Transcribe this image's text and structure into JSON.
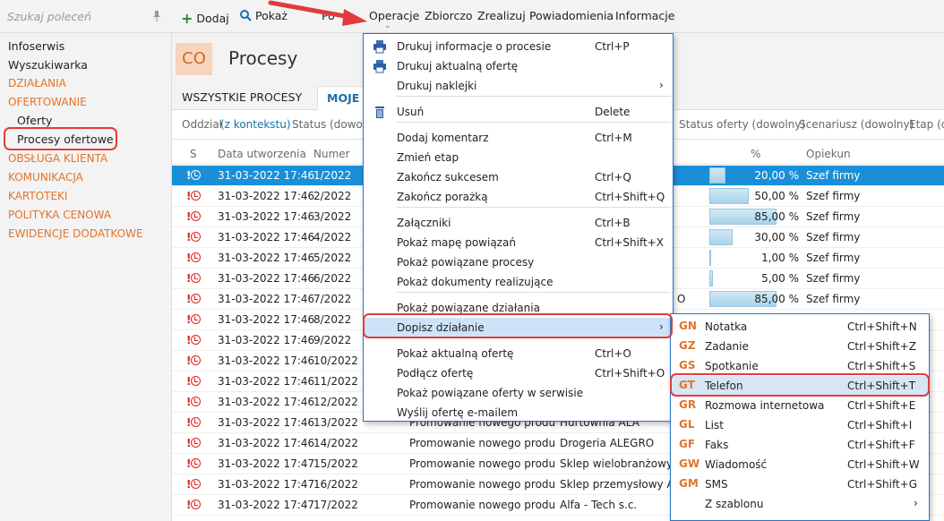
{
  "sidebar": {
    "search_placeholder": "Szukaj poleceń",
    "items": [
      {
        "label": "Infoserwis",
        "type": "plain"
      },
      {
        "label": "Wyszukiwarka",
        "type": "plain"
      },
      {
        "label": "DZIAŁANIA",
        "type": "category"
      },
      {
        "label": "OFERTOWANIE",
        "type": "category"
      },
      {
        "label": "Oferty",
        "type": "sub"
      },
      {
        "label": "Procesy ofertowe",
        "type": "sub"
      },
      {
        "label": "OBSŁUGA KLIENTA",
        "type": "category"
      },
      {
        "label": "KOMUNIKACJA",
        "type": "category"
      },
      {
        "label": "KARTOTEKI",
        "type": "category"
      },
      {
        "label": "POLITYKA CENOWA",
        "type": "category"
      },
      {
        "label": "EWIDENCJE DODATKOWE",
        "type": "category"
      }
    ]
  },
  "toolbar": {
    "add": "Dodaj",
    "show": "Pokaż",
    "hidden_item": "Po",
    "menus": [
      "Operacje",
      "Zbiorczo",
      "Zrealizuj",
      "Powiadomienia",
      "Informacje"
    ]
  },
  "page": {
    "badge": "CO",
    "title": "Procesy",
    "tabs": [
      "WSZYSTKIE PROCESY",
      "MOJE"
    ],
    "filter_dept_label": "Oddział",
    "filter_dept_value": "(z kontekstu)",
    "filter_status": "Status (dowolny)",
    "filter_offer_status": "Status oferty (dowolny)",
    "filter_scenario": "Scenariusz (dowolny)",
    "filter_stage": "Etap (dowolny)"
  },
  "table": {
    "columns": {
      "s": "S",
      "date": "Data utworzenia",
      "number": "Numer",
      "percent": "%",
      "owner": "Opiekun"
    },
    "rows": [
      {
        "date": "31-03-2022 17:46",
        "number": "1/2022",
        "name": "",
        "client": "",
        "percent": 20,
        "percent_label": "20,00 %",
        "owner": "Szef firmy"
      },
      {
        "date": "31-03-2022 17:46",
        "number": "2/2022",
        "name": "",
        "client": "",
        "percent": 50,
        "percent_label": "50,00 %",
        "owner": "Szef firmy"
      },
      {
        "date": "31-03-2022 17:46",
        "number": "3/2022",
        "name": "",
        "client": "",
        "percent": 85,
        "percent_label": "85,00 %",
        "owner": "Szef firmy"
      },
      {
        "date": "31-03-2022 17:46",
        "number": "4/2022",
        "name": "",
        "client": "",
        "percent": 30,
        "percent_label": "30,00 %",
        "owner": "Szef firmy"
      },
      {
        "date": "31-03-2022 17:46",
        "number": "5/2022",
        "name": "",
        "client": "",
        "percent": 1,
        "percent_label": "1,00 %",
        "owner": "Szef firmy"
      },
      {
        "date": "31-03-2022 17:46",
        "number": "6/2022",
        "name": "",
        "client": "",
        "percent": 5,
        "percent_label": "5,00 %",
        "owner": "Szef firmy"
      },
      {
        "date": "31-03-2022 17:46",
        "number": "7/2022",
        "name": "",
        "client": "O",
        "percent": 85,
        "percent_label": "85,00 %",
        "owner": "Szef firmy"
      },
      {
        "date": "31-03-2022 17:46",
        "number": "8/2022",
        "name": "",
        "client": "",
        "percent": null,
        "percent_label": "",
        "owner": ""
      },
      {
        "date": "31-03-2022 17:46",
        "number": "9/2022",
        "name": "",
        "client": "",
        "percent": null,
        "percent_label": "",
        "owner": ""
      },
      {
        "date": "31-03-2022 17:46",
        "number": "10/2022",
        "name": "",
        "client": "",
        "percent": null,
        "percent_label": "",
        "owner": ""
      },
      {
        "date": "31-03-2022 17:46",
        "number": "11/2022",
        "name": "",
        "client": "",
        "percent": null,
        "percent_label": "",
        "owner": ""
      },
      {
        "date": "31-03-2022 17:46",
        "number": "12/2022",
        "name": "",
        "client": "",
        "percent": null,
        "percent_label": "",
        "owner": ""
      },
      {
        "date": "31-03-2022 17:46",
        "number": "13/2022",
        "name": "Promowanie nowego produ...",
        "client": "Hurtownia ALA",
        "percent": null,
        "percent_label": "",
        "owner": ""
      },
      {
        "date": "31-03-2022 17:46",
        "number": "14/2022",
        "name": "Promowanie nowego produ...",
        "client": "Drogeria ALEGRO",
        "percent": null,
        "percent_label": "",
        "owner": ""
      },
      {
        "date": "31-03-2022 17:47",
        "number": "15/2022",
        "name": "Promowanie nowego produ...",
        "client": "Sklep wielobranżowy  A",
        "percent": null,
        "percent_label": "",
        "owner": ""
      },
      {
        "date": "31-03-2022 17:47",
        "number": "16/2022",
        "name": "Promowanie nowego produ...",
        "client": "Sklep przemysłowy ALF",
        "percent": null,
        "percent_label": "",
        "owner": ""
      },
      {
        "date": "31-03-2022 17:47",
        "number": "17/2022",
        "name": "Promowanie nowego produ...",
        "client": "Alfa - Tech s.c.",
        "percent": null,
        "percent_label": "",
        "owner": ""
      }
    ]
  },
  "menu": {
    "items": [
      {
        "label": "Drukuj informacje o procesie",
        "shortcut": "Ctrl+P",
        "icon": "printer-icon"
      },
      {
        "label": "Drukuj aktualną ofertę",
        "shortcut": "",
        "icon": "printer-icon"
      },
      {
        "label": "Drukuj naklejki",
        "shortcut": "",
        "submenu": true
      },
      {
        "label": "Usuń",
        "shortcut": "Delete",
        "icon": "trash-icon"
      },
      {
        "label": "Dodaj komentarz",
        "shortcut": "Ctrl+M"
      },
      {
        "label": "Zmień etap",
        "shortcut": ""
      },
      {
        "label": "Zakończ sukcesem",
        "shortcut": "Ctrl+Q"
      },
      {
        "label": "Zakończ porażką",
        "shortcut": "Ctrl+Shift+Q"
      },
      {
        "label": "Załączniki",
        "shortcut": "Ctrl+B"
      },
      {
        "label": "Pokaż mapę powiązań",
        "shortcut": "Ctrl+Shift+X"
      },
      {
        "label": "Pokaż powiązane procesy",
        "shortcut": ""
      },
      {
        "label": "Pokaż dokumenty realizujące",
        "shortcut": ""
      },
      {
        "label": "Pokaż powiązane działania",
        "shortcut": ""
      },
      {
        "label": "Dopisz działanie",
        "shortcut": "",
        "submenu": true
      },
      {
        "label": "Pokaż aktualną ofertę",
        "shortcut": "Ctrl+O"
      },
      {
        "label": "Podłącz ofertę",
        "shortcut": "Ctrl+Shift+O"
      },
      {
        "label": "Pokaż powiązane oferty w serwisie",
        "shortcut": ""
      },
      {
        "label": "Wyślij ofertę e-mailem",
        "shortcut": ""
      }
    ]
  },
  "submenu": {
    "items": [
      {
        "code": "GN",
        "label": "Notatka",
        "shortcut": "Ctrl+Shift+N"
      },
      {
        "code": "GZ",
        "label": "Zadanie",
        "shortcut": "Ctrl+Shift+Z"
      },
      {
        "code": "GS",
        "label": "Spotkanie",
        "shortcut": "Ctrl+Shift+S"
      },
      {
        "code": "GT",
        "label": "Telefon",
        "shortcut": "Ctrl+Shift+T"
      },
      {
        "code": "GR",
        "label": "Rozmowa internetowa",
        "shortcut": "Ctrl+Shift+E"
      },
      {
        "code": "GL",
        "label": "List",
        "shortcut": "Ctrl+Shift+I"
      },
      {
        "code": "GF",
        "label": "Faks",
        "shortcut": "Ctrl+Shift+F"
      },
      {
        "code": "GW",
        "label": "Wiadomość",
        "shortcut": "Ctrl+Shift+W"
      },
      {
        "code": "GM",
        "label": "SMS",
        "shortcut": "Ctrl+Shift+G"
      },
      {
        "code": "",
        "label": "Z szablonu",
        "shortcut": "",
        "submenu": true
      }
    ]
  },
  "colors": {
    "accent_orange": "#e2742a",
    "selection_blue": "#1a8fd8",
    "menu_border": "#2a73c9",
    "highlight_red": "#e23b3b"
  }
}
